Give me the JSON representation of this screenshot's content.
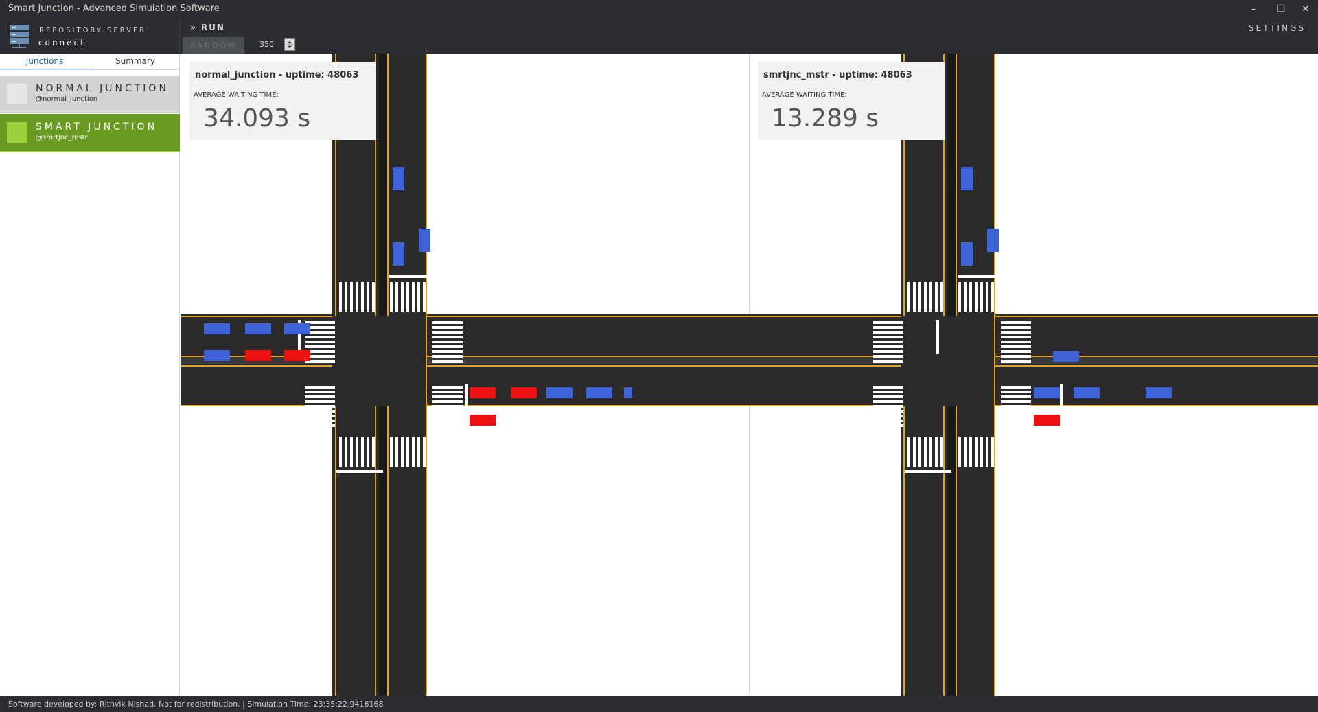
{
  "window": {
    "title": "Smart Junction - Advanced Simulation Software",
    "minimize_glyph": "–",
    "restore_glyph": "❐",
    "close_glyph": "✕"
  },
  "toolbar": {
    "repo_label": "REPOSITORY SERVER",
    "repo_link": "connect",
    "run_label": "» RUN",
    "random_label": "RANDOM",
    "count_value": "350",
    "settings_label": "SETTINGS"
  },
  "sidebar": {
    "tabs": [
      {
        "label": "Junctions",
        "active": true
      },
      {
        "label": "Summary",
        "active": false
      }
    ],
    "junctions": [
      {
        "name": "NORMAL JUNCTION",
        "handle": "@normal_junction",
        "swatch": "#e6e6e6",
        "bg": "#d4d4d4",
        "text": "#333333",
        "selected": false
      },
      {
        "name": "SMART JUNCTION",
        "handle": "@smrtjnc_mstr",
        "swatch": "#9bd23c",
        "bg": "#6a9a22",
        "text": "#ffffff",
        "selected": true
      }
    ]
  },
  "panels": [
    {
      "title": "normal_junction - uptime: 48063",
      "label": "AVERAGE WAITING TIME:",
      "value": "34.093 s"
    },
    {
      "title": "smrtjnc_mstr - uptime: 48063",
      "label": "AVERAGE WAITING TIME:",
      "value": "13.289 s"
    }
  ],
  "status": {
    "text": "Software developed by: Rithvik Nishad. Not for redistribution.  |  Simulation Time:  23:35:22.9416168"
  },
  "colors": {
    "road": "#2b2b2b",
    "lane_line": "#e7a21b",
    "zebra": "#ffffff",
    "car_blue": "#3e63d9",
    "car_red": "#ee1111"
  }
}
